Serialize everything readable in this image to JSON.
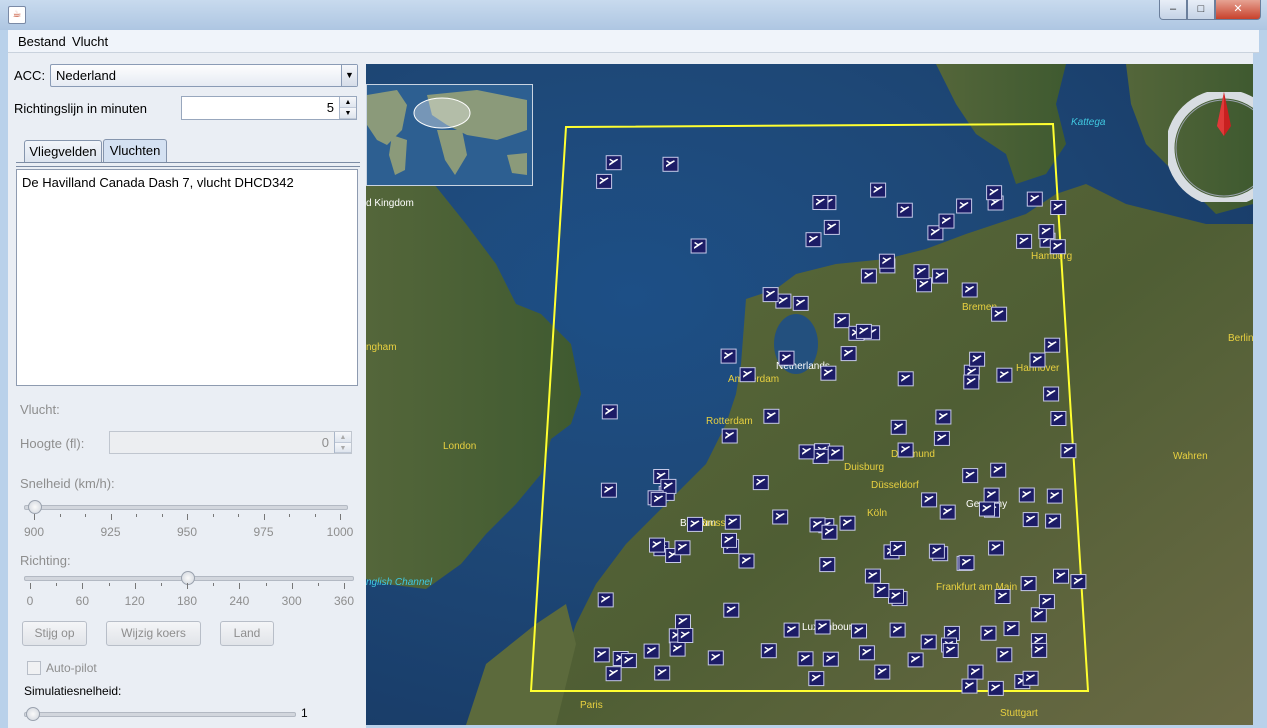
{
  "window": {
    "title": "",
    "buttons": {
      "minimize": "–",
      "maximize": "□",
      "close": "✕"
    }
  },
  "menu": {
    "items": [
      "Bestand",
      "Vlucht"
    ]
  },
  "acc": {
    "label": "ACC:",
    "value": "Nederland"
  },
  "richting_minuten": {
    "label": "Richtingslijn in minuten",
    "value": "5"
  },
  "tabs": [
    {
      "label": "Vliegvelden",
      "active": false
    },
    {
      "label": "Vluchten",
      "active": true
    }
  ],
  "flight_list": [
    "De Havilland Canada Dash 7, vlucht DHCD342"
  ],
  "vlucht_label": "Vlucht:",
  "hoogte": {
    "label": "Hoogte (fl):",
    "value": "0"
  },
  "snelheid": {
    "label": "Snelheid (km/h):",
    "ticks": [
      "900",
      "925",
      "950",
      "975",
      "1000"
    ],
    "value": 900
  },
  "richting": {
    "label": "Richting:",
    "ticks": [
      "0",
      "60",
      "120",
      "180",
      "240",
      "300",
      "360"
    ],
    "value": 180
  },
  "buttons": {
    "stijg_op": "Stijg op",
    "wijzig_koers": "Wijzig koers",
    "land": "Land"
  },
  "autopilot": {
    "label": "Auto-pilot",
    "checked": false
  },
  "simulatie": {
    "label": "Simulatiesnelheid:",
    "value": "1"
  },
  "map": {
    "place_labels": [
      {
        "text": "d Kingdom",
        "color": "#ffffff"
      },
      {
        "text": "ngham",
        "color": "#e8d040"
      },
      {
        "text": "London",
        "color": "#e8d040"
      },
      {
        "text": "nglish Channel",
        "color": "#40c8e0"
      },
      {
        "text": "Kattega",
        "color": "#40c8e0"
      },
      {
        "text": "Netherlands",
        "color": "#ffffff"
      },
      {
        "text": "Amsterdam",
        "color": "#e8d040"
      },
      {
        "text": "Rotterdam",
        "color": "#e8d040"
      },
      {
        "text": "Belgium",
        "color": "#ffffff"
      },
      {
        "text": "Brussel",
        "color": "#e8d040"
      },
      {
        "text": "Duisburg",
        "color": "#e8d040"
      },
      {
        "text": "Dortmund",
        "color": "#e8d040"
      },
      {
        "text": "Düsseldorf",
        "color": "#e8d040"
      },
      {
        "text": "Köln",
        "color": "#e8d040"
      },
      {
        "text": "Germany",
        "color": "#ffffff"
      },
      {
        "text": "Frankfurt am Main",
        "color": "#e8d040"
      },
      {
        "text": "Luxembourg",
        "color": "#ffffff"
      },
      {
        "text": "Stuttgart",
        "color": "#e8d040"
      },
      {
        "text": "Paris",
        "color": "#e8d040"
      },
      {
        "text": "Bremen",
        "color": "#e8d040"
      },
      {
        "text": "Hannover",
        "color": "#e8d040"
      },
      {
        "text": "Hamburg",
        "color": "#e8d040"
      },
      {
        "text": "Berlin",
        "color": "#e8d040"
      },
      {
        "text": "Wahren",
        "color": "#e8d040"
      }
    ],
    "sector_color": "#ffff30",
    "aircraft_icon_color": "#1c1c66",
    "aircraft_count": 150
  }
}
